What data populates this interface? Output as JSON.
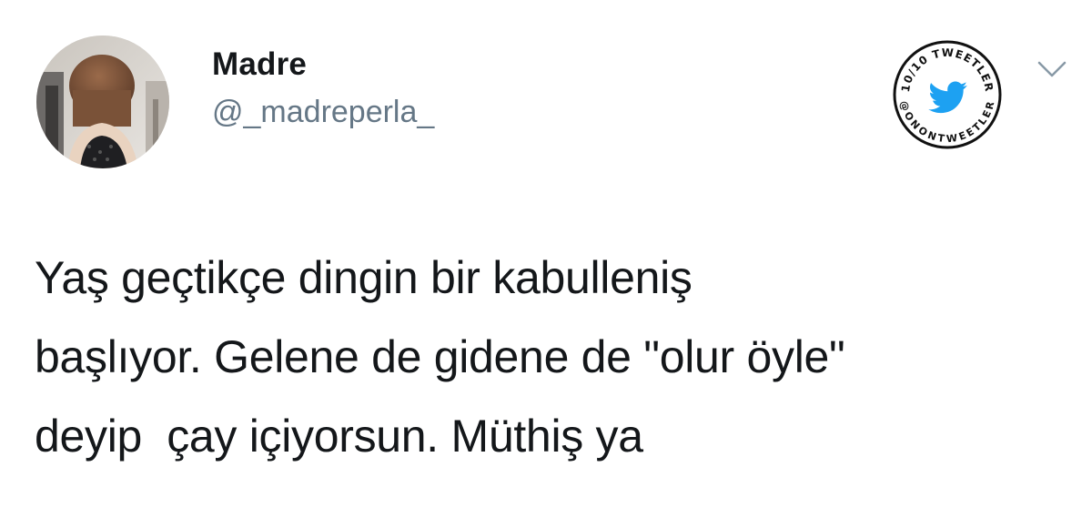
{
  "tweet": {
    "author": {
      "display_name": "Madre",
      "handle": "@_madreperla_"
    },
    "text": "Yaş geçtikçe dingin bir kabulleniş\nbaşlıyor. Gelene de gidene de \"olur öyle\"\ndeyip  çay içiyorsun. Müthiş ya"
  },
  "watermark": {
    "top_text": "10/10 TWEETLER",
    "bottom_text": "@ONONTWEETLER",
    "icon": "twitter-bird-icon",
    "icon_color": "#1da1f2"
  },
  "menu": {
    "icon": "chevron-down-icon"
  },
  "colors": {
    "name": "#14171a",
    "handle": "#657786",
    "text": "#14171a",
    "chevron": "#8899a6"
  }
}
